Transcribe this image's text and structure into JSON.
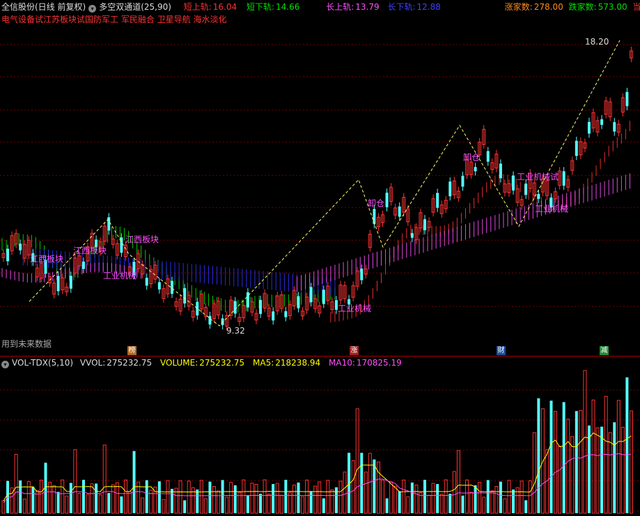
{
  "header": {
    "stock_name": "全信股份(日线 前复权)",
    "indicator_name": "多空双通道(25,90)",
    "short_upper_label": "短上轨:",
    "short_upper_value": "16.04",
    "short_lower_label": "短下轨:",
    "short_lower_value": "14.66",
    "long_upper_label": "长上轨:",
    "long_upper_value": "13.79",
    "long_lower_label": "长下轨:",
    "long_lower_value": "12.88",
    "up_count_label": "涨家数:",
    "up_count_value": "278.00",
    "down_count_label": "跌家数:",
    "down_count_value": "573.00",
    "daily_label": "当日冷◇"
  },
  "concepts": "电气设备试江苏板块试国防军工 军民融合 卫星导航 海水淡化",
  "future_data_note": "用到未来数据",
  "annotations": {
    "price_high": "18.20",
    "price_low": "9.32",
    "tags": [
      "江西板块",
      "江西板块",
      "江西板块",
      "工业机械",
      "工业机械",
      "卸仓",
      "卸仓",
      "工业机械试",
      "工业机械"
    ]
  },
  "event_markers": [
    {
      "label": "榜",
      "color": "#b06a2a"
    },
    {
      "label": "涨",
      "color": "#a02020"
    },
    {
      "label": "财",
      "color": "#2050a0"
    },
    {
      "label": "减",
      "color": "#2a8a3a"
    }
  ],
  "volume_header": {
    "name": "VOL-TDX(5,10)",
    "vvol_label": "VVOL:",
    "vvol_value": "275232.75",
    "volume_label": "VOLUME:",
    "volume_value": "275232.75",
    "ma5_label": "MA5:",
    "ma5_value": "218238.94",
    "ma10_label": "MA10:",
    "ma10_value": "170825.19"
  },
  "colors": {
    "up": "#ff3232",
    "down": "#54ffff",
    "short_channel": "#00e000",
    "long_channel": "#3030ff",
    "lower_red_channel": "#ff3232",
    "lower_pink_channel": "#ff50ff",
    "ma5": "#ffff00",
    "ma10": "#ff50ff"
  }
}
